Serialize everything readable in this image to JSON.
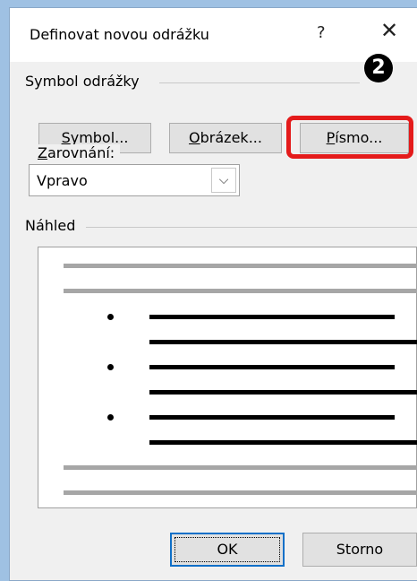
{
  "dialog": {
    "title": "Definovat novou odrážku",
    "help_label": "?",
    "close_label": "✕"
  },
  "symbol_section": {
    "label": "Symbol odrážky",
    "buttons": {
      "symbol": {
        "mnemonic": "S",
        "rest": "ymbol..."
      },
      "picture": {
        "mnemonic": "O",
        "rest": "brázek..."
      },
      "font": {
        "mnemonic": "P",
        "rest": "ísmo..."
      }
    }
  },
  "step_badge": "2",
  "alignment": {
    "label_mnemonic": "Z",
    "label_rest": "arovnání:",
    "value": "Vpravo",
    "arrow": "⌵"
  },
  "preview": {
    "label": "Náhled"
  },
  "footer": {
    "ok_label": "OK",
    "cancel_label": "Storno"
  },
  "colors": {
    "highlight": "#e41b1b",
    "focus_border": "#1070c8"
  }
}
